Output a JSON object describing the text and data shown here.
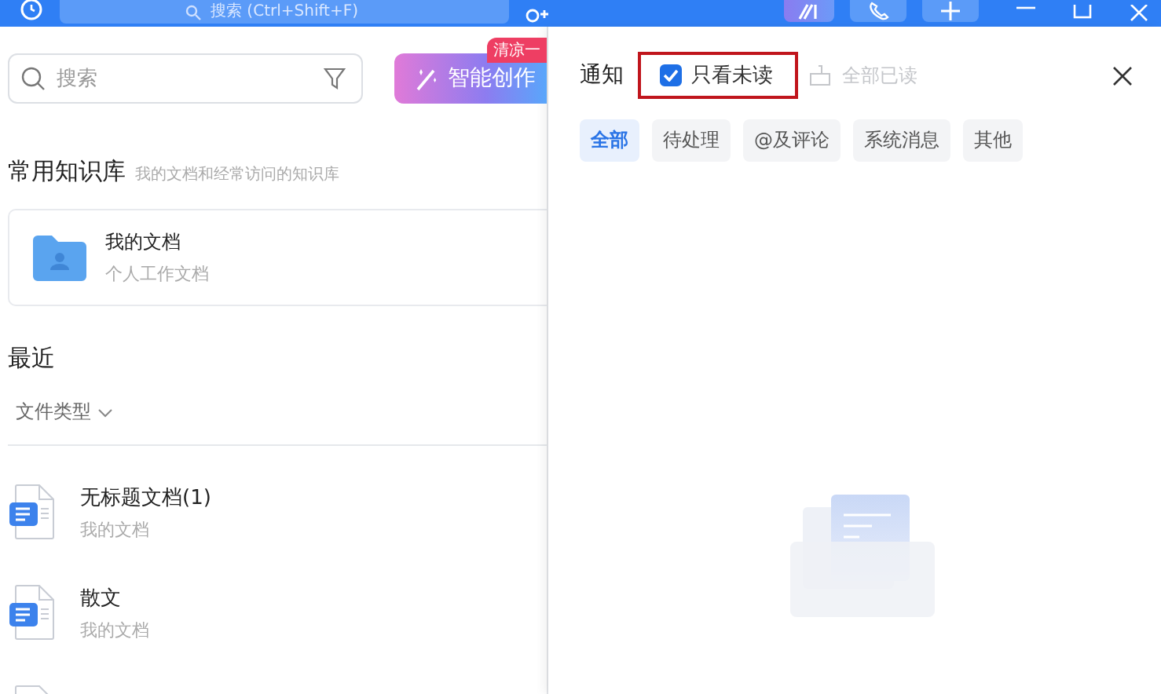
{
  "title_bar": {
    "search": {
      "placeholder": "搜索 (Ctrl+Shift+F)"
    }
  },
  "sidebar": {
    "search": {
      "placeholder": "搜索"
    },
    "create_button": {
      "label": "智能创作",
      "badge": "清凉一"
    },
    "knowledge": {
      "title": "常用知识库",
      "subtitle": "我的文档和经常访问的知识库",
      "items": [
        {
          "name": "我的文档",
          "description": "个人工作文档"
        }
      ]
    },
    "recent": {
      "title": "最近",
      "filter": "文件类型",
      "items": [
        {
          "name": "无标题文档(1)",
          "location": "我的文档"
        },
        {
          "name": "散文",
          "location": "我的文档"
        }
      ]
    }
  },
  "notifications": {
    "title": "通知",
    "unread_only": {
      "label": "只看未读",
      "checked": true,
      "highlighted": true
    },
    "mark_all_read": {
      "label": "全部已读",
      "disabled": true
    },
    "tabs": [
      {
        "label": "全部",
        "selected": true
      },
      {
        "label": "待处理",
        "selected": false
      },
      {
        "label": "@及评论",
        "selected": false
      },
      {
        "label": "系统消息",
        "selected": false
      },
      {
        "label": "其他",
        "selected": false
      }
    ]
  }
}
